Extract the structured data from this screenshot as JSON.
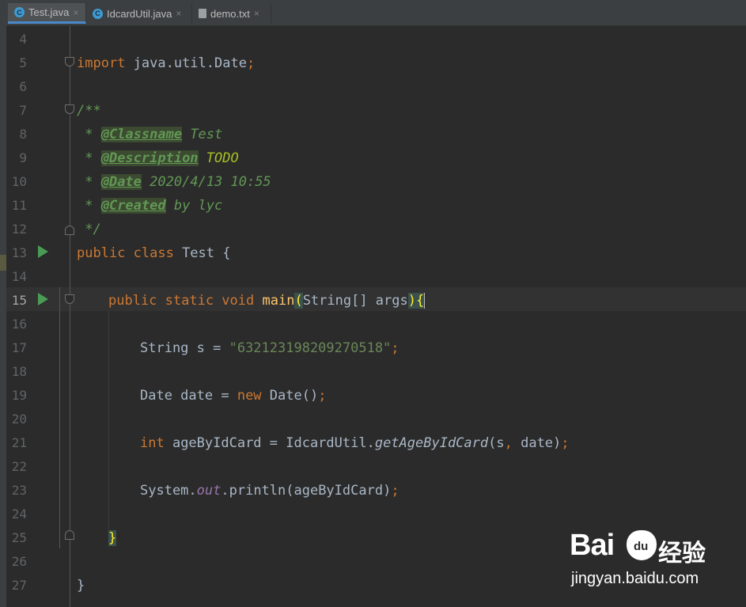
{
  "tabs": [
    {
      "label": "Test.java",
      "icon": "java-class-icon",
      "active": true
    },
    {
      "label": "IdcardUtil.java",
      "icon": "java-class-icon",
      "active": false
    },
    {
      "label": "demo.txt",
      "icon": "text-file-icon",
      "active": false
    }
  ],
  "tab_close_glyph": "×",
  "line_numbers": [
    "4",
    "5",
    "6",
    "7",
    "8",
    "9",
    "10",
    "11",
    "12",
    "13",
    "14",
    "15",
    "16",
    "17",
    "18",
    "19",
    "20",
    "21",
    "22",
    "23",
    "24",
    "25",
    "26",
    "27"
  ],
  "code": {
    "l5": {
      "kw": "import",
      "rest": " java.util.Date",
      "semi": ";"
    },
    "l7": "/**",
    "l8": {
      "star": " * ",
      "tag": "@Classname",
      "val": " Test"
    },
    "l9": {
      "star": " * ",
      "tag": "@Description",
      "val": " TODO"
    },
    "l10": {
      "star": " * ",
      "tag": "@Date",
      "val": " 2020/4/13 10:55"
    },
    "l11": {
      "star": " * ",
      "tag": "@Created",
      "val": " by lyc"
    },
    "l12": " */",
    "l13": {
      "kw": "public class",
      "name": " Test {"
    },
    "l15": {
      "kw": "public static void",
      "method": "main",
      "lp": "(",
      "params": "String[] args",
      "rp": ")",
      "brace": "{"
    },
    "l17": {
      "type": "String s = ",
      "str": "\"632123198209270518\"",
      "semi": ";"
    },
    "l19": {
      "pre": "Date date = ",
      "kw": "new",
      "post": " Date()",
      "semi": ";"
    },
    "l21": {
      "kw": "int",
      "pre": " ageByIdCard = IdcardUtil.",
      "static": "getAgeByIdCard",
      "args": "(s",
      "comma": ",",
      "args2": " date)",
      "semi": ";"
    },
    "l23": {
      "pre": "System.",
      "field": "out",
      "post": ".println(ageByIdCard)",
      "semi": ";"
    },
    "l25": "}",
    "l27": "}"
  },
  "watermark": {
    "brand_left": "Bai",
    "brand_paw": "du",
    "brand_right": "经验",
    "url": "jingyan.baidu.com"
  },
  "colors": {
    "background": "#2b2b2b",
    "keyword": "#cc7832",
    "string": "#6a8759",
    "doc_comment": "#629755",
    "method": "#ffc66d",
    "run_icon": "#499c54"
  }
}
